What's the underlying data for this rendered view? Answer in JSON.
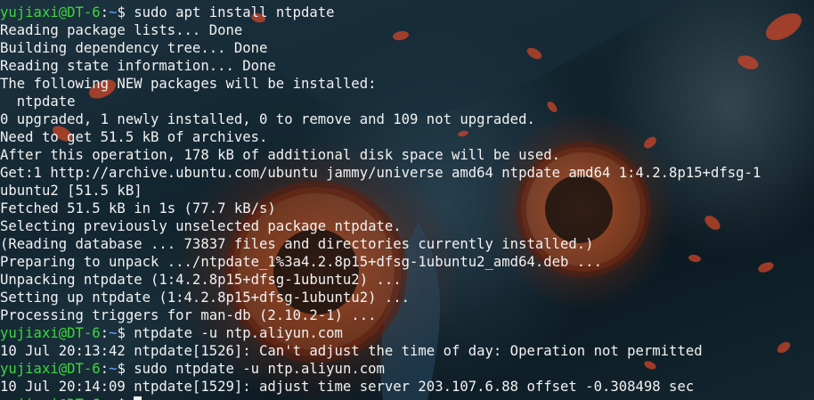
{
  "terminal": {
    "prompt": {
      "user_host": "yujiaxi@DT-6",
      "separator": ":",
      "cwd": "~",
      "symbol": "$ "
    },
    "lines": [
      {
        "kind": "prompt",
        "command": "sudo apt install ntpdate"
      },
      {
        "kind": "output",
        "text": "Reading package lists... Done"
      },
      {
        "kind": "output",
        "text": "Building dependency tree... Done"
      },
      {
        "kind": "output",
        "text": "Reading state information... Done"
      },
      {
        "kind": "output",
        "text": "The following NEW packages will be installed:"
      },
      {
        "kind": "output",
        "text": "  ntpdate"
      },
      {
        "kind": "output",
        "text": "0 upgraded, 1 newly installed, 0 to remove and 109 not upgraded."
      },
      {
        "kind": "output",
        "text": "Need to get 51.5 kB of archives."
      },
      {
        "kind": "output",
        "text": "After this operation, 178 kB of additional disk space will be used."
      },
      {
        "kind": "output",
        "text": "Get:1 http://archive.ubuntu.com/ubuntu jammy/universe amd64 ntpdate amd64 1:4.2.8p15+dfsg-1"
      },
      {
        "kind": "output",
        "text": "ubuntu2 [51.5 kB]"
      },
      {
        "kind": "output",
        "text": "Fetched 51.5 kB in 1s (77.7 kB/s)"
      },
      {
        "kind": "output",
        "text": "Selecting previously unselected package ntpdate."
      },
      {
        "kind": "output",
        "text": "(Reading database ... 73837 files and directories currently installed.)"
      },
      {
        "kind": "output",
        "text": "Preparing to unpack .../ntpdate_1%3a4.2.8p15+dfsg-1ubuntu2_amd64.deb ..."
      },
      {
        "kind": "output",
        "text": "Unpacking ntpdate (1:4.2.8p15+dfsg-1ubuntu2) ..."
      },
      {
        "kind": "output",
        "text": "Setting up ntpdate (1:4.2.8p15+dfsg-1ubuntu2) ..."
      },
      {
        "kind": "output",
        "text": "Processing triggers for man-db (2.10.2-1) ..."
      },
      {
        "kind": "prompt",
        "command": "ntpdate -u ntp.aliyun.com"
      },
      {
        "kind": "output",
        "text": "10 Jul 20:13:42 ntpdate[1526]: Can't adjust the time of day: Operation not permitted"
      },
      {
        "kind": "prompt",
        "command": "sudo ntpdate -u ntp.aliyun.com"
      },
      {
        "kind": "output",
        "text": "10 Jul 20:14:09 ntpdate[1529]: adjust time server 203.107.6.88 offset -0.308498 sec"
      }
    ],
    "colors": {
      "prompt_user_host": "#3ed63e",
      "prompt_cwd": "#6aa7ff",
      "text": "#f2f2f2"
    }
  }
}
